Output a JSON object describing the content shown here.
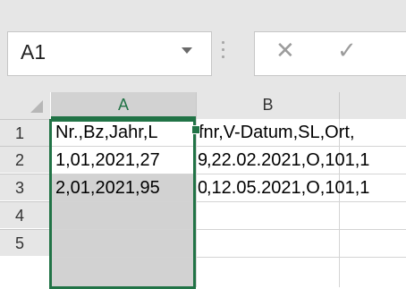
{
  "name_box": {
    "value": "A1"
  },
  "formula_bar": {
    "cancel_symbol": "✕",
    "enter_symbol": "✓"
  },
  "columns": [
    "A",
    "B",
    ""
  ],
  "rows": [
    "1",
    "2",
    "3",
    "4",
    "5"
  ],
  "cells": {
    "r1": {
      "a": "Nr.,Bz,Jahr,L",
      "b": "fnr,V-Datum,SL,Ort,"
    },
    "r2": {
      "a": "1,01,2021,27",
      "a_tail": "9",
      "b": ",22.02.2021,O,101,1"
    },
    "r3": {
      "a": "2,01,2021,95",
      "a_tail": "0",
      "b": ",12.05.2021,O,101,1"
    }
  },
  "colors": {
    "selection_green": "#217346",
    "header_gray": "#e6e6e6",
    "selected_header_gray": "#d2d2d2"
  }
}
